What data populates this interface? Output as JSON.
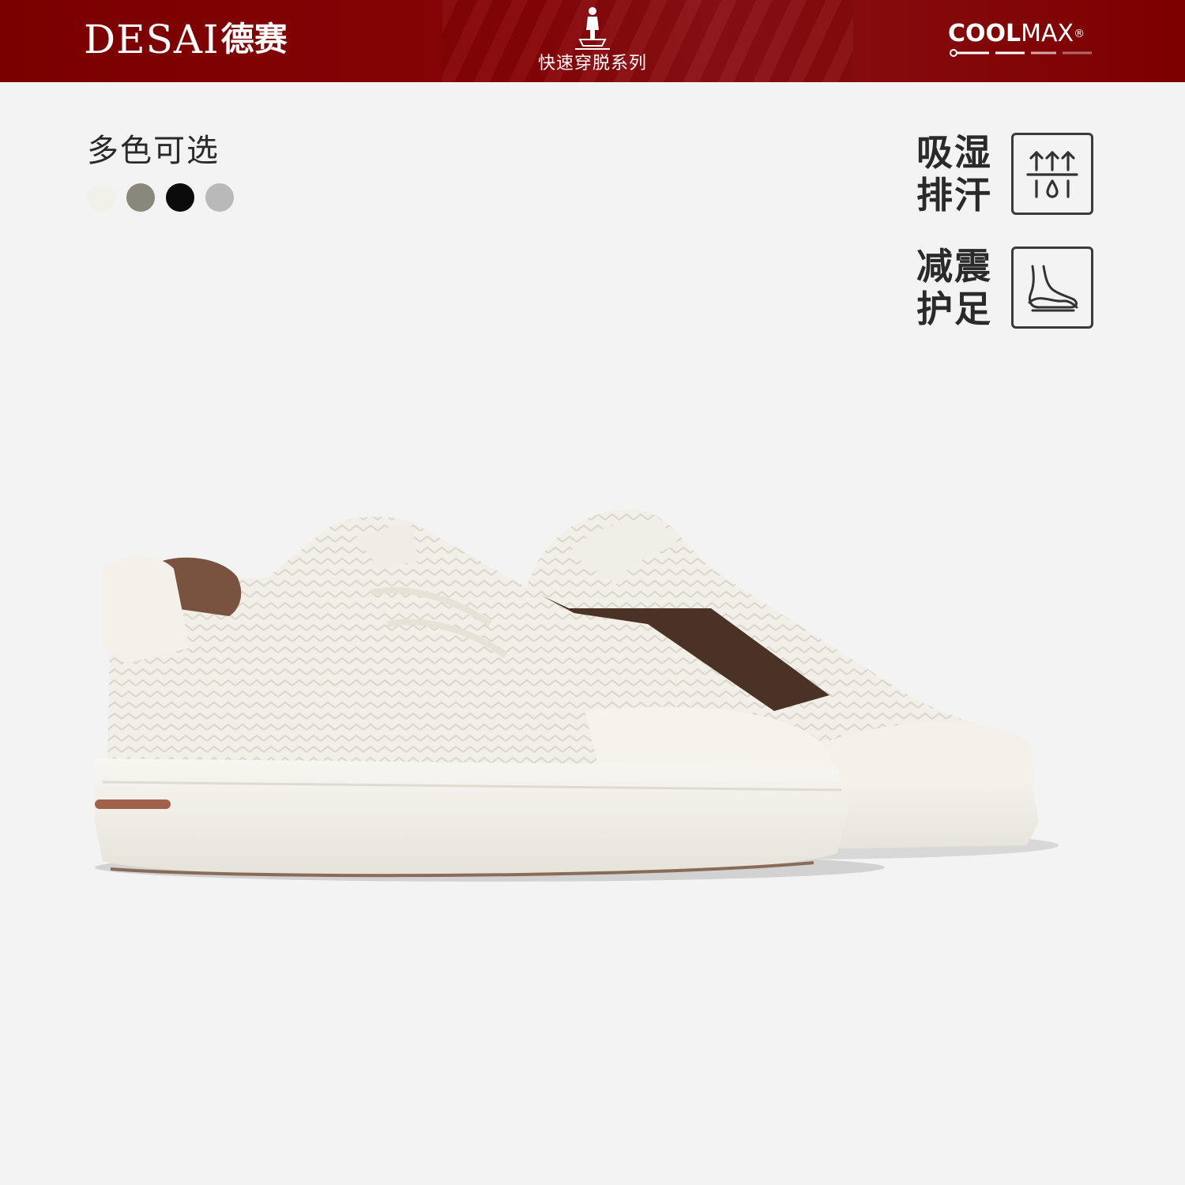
{
  "header": {
    "brand_latin": "DESAI",
    "brand_cn": "德赛",
    "series_label": "快速穿脱系列",
    "badge_bold": "COOL",
    "badge_light": "MAX",
    "badge_mark": "®",
    "background_color": "#7c0000"
  },
  "colors": {
    "title": "多色可选",
    "swatches": [
      {
        "name": "white",
        "color": "#f1f0ea"
      },
      {
        "name": "khaki",
        "color": "#8a877c"
      },
      {
        "name": "black",
        "color": "#0b0b0b"
      },
      {
        "name": "grey",
        "color": "#b9b9b9"
      }
    ]
  },
  "features": [
    {
      "line1": "吸湿",
      "line2": "排汗",
      "icon": "moisture-wicking-icon"
    },
    {
      "line1": "减震",
      "line2": "护足",
      "icon": "foot-cushion-icon"
    }
  ],
  "product": {
    "image": "white-woven-sneakers-pair",
    "upper_color": "#f2f0e8",
    "lining_color": "#6a4a3a"
  }
}
